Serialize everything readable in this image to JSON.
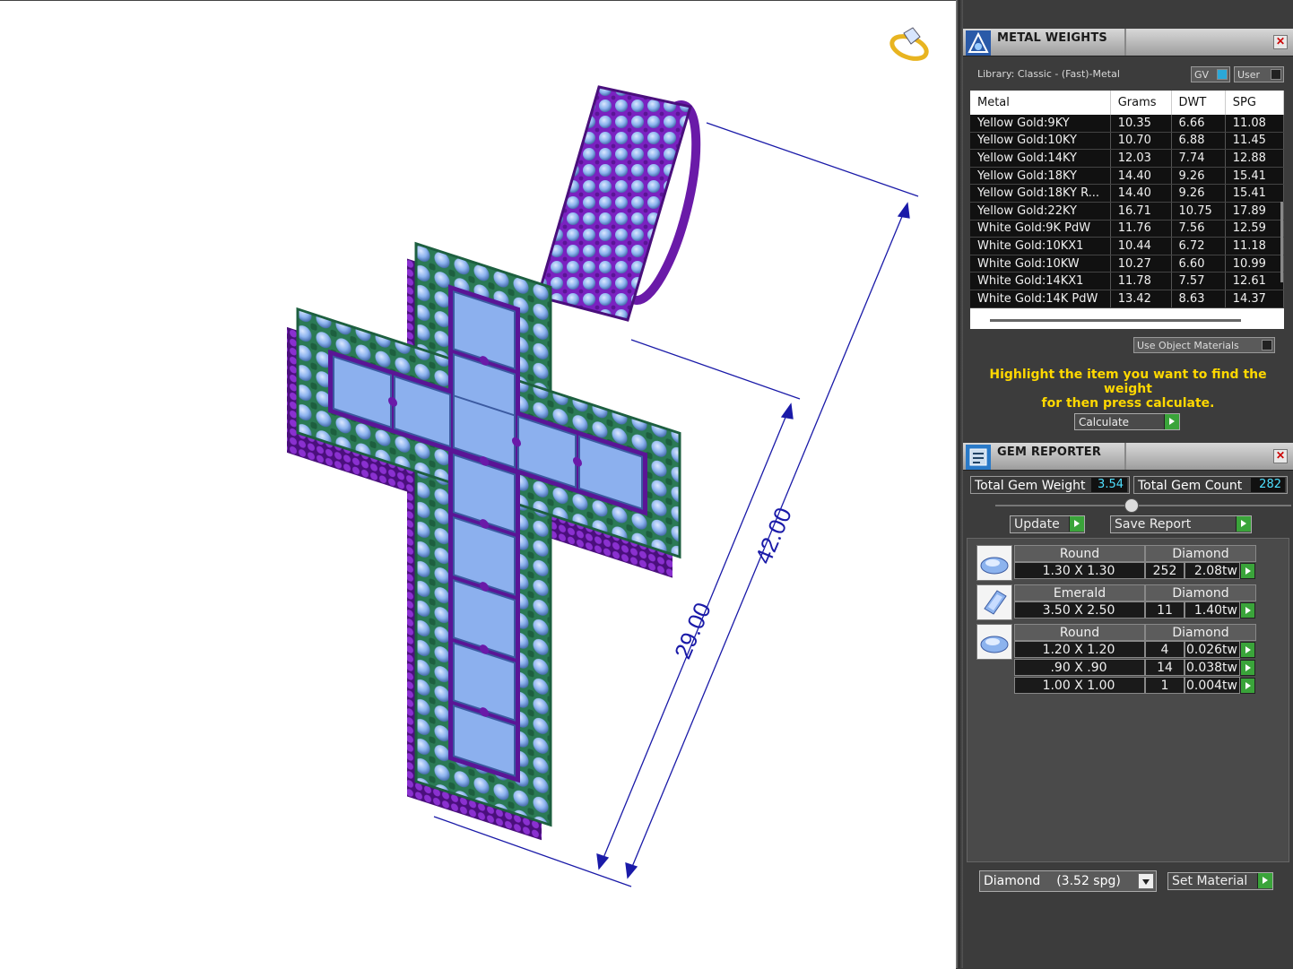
{
  "dimensions": {
    "overall": "42.00",
    "body": "29.00"
  },
  "metal_weights": {
    "title": "METAL WEIGHTS",
    "library": "Library: Classic - (Fast)-Metal",
    "gv_label": "GV",
    "user_label": "User",
    "columns": [
      "Metal",
      "Grams",
      "DWT",
      "SPG"
    ],
    "rows": [
      [
        "Yellow Gold:9KY",
        "10.35",
        "6.66",
        "11.08"
      ],
      [
        "Yellow Gold:10KY",
        "10.70",
        "6.88",
        "11.45"
      ],
      [
        "Yellow Gold:14KY",
        "12.03",
        "7.74",
        "12.88"
      ],
      [
        "Yellow Gold:18KY",
        "14.40",
        "9.26",
        "15.41"
      ],
      [
        "Yellow Gold:18KY R...",
        "14.40",
        "9.26",
        "15.41"
      ],
      [
        "Yellow Gold:22KY",
        "16.71",
        "10.75",
        "17.89"
      ],
      [
        "White Gold:9K PdW",
        "11.76",
        "7.56",
        "12.59"
      ],
      [
        "White Gold:10KX1",
        "10.44",
        "6.72",
        "11.18"
      ],
      [
        "White Gold:10KW",
        "10.27",
        "6.60",
        "10.99"
      ],
      [
        "White Gold:14KX1",
        "11.78",
        "7.57",
        "12.61"
      ],
      [
        "White Gold:14K PdW",
        "13.42",
        "8.63",
        "14.37"
      ]
    ],
    "use_object_materials": "Use Object Materials",
    "highlight_line1": "Highlight the item you want to find the weight",
    "highlight_line2": "for then press calculate.",
    "calculate": "Calculate"
  },
  "gem_reporter": {
    "title": "GEM REPORTER",
    "total_weight_label": "Total Gem Weight",
    "total_weight": "3.54",
    "total_count_label": "Total Gem Count",
    "total_count": "282",
    "update": "Update",
    "save_report": "Save Report",
    "groups": [
      {
        "shape": "Round",
        "type": "Diamond",
        "icon": "round-gem-icon",
        "rows": [
          {
            "size": "1.30 X 1.30",
            "qty": "252",
            "tw": "2.08tw"
          }
        ]
      },
      {
        "shape": "Emerald",
        "type": "Diamond",
        "icon": "emerald-gem-icon",
        "rows": [
          {
            "size": "3.50 X 2.50",
            "qty": "11",
            "tw": "1.40tw"
          }
        ]
      },
      {
        "shape": "Round",
        "type": "Diamond",
        "icon": "round-gem-icon",
        "rows": [
          {
            "size": "1.20 X 1.20",
            "qty": "4",
            "tw": "0.026tw"
          },
          {
            "size": ".90 X .90",
            "qty": "14",
            "tw": "0.038tw"
          },
          {
            "size": "1.00 X 1.00",
            "qty": "1",
            "tw": "0.004tw"
          }
        ]
      }
    ],
    "material_select": "Diamond",
    "material_spg": "(3.52 spg)",
    "set_material": "Set Material"
  },
  "colors": {
    "metal": "#7a1fb8",
    "gem": "#8eb6ee",
    "prong": "#1f6a4a",
    "dimension": "#1a1aa8",
    "highlight": "#ffd800"
  }
}
